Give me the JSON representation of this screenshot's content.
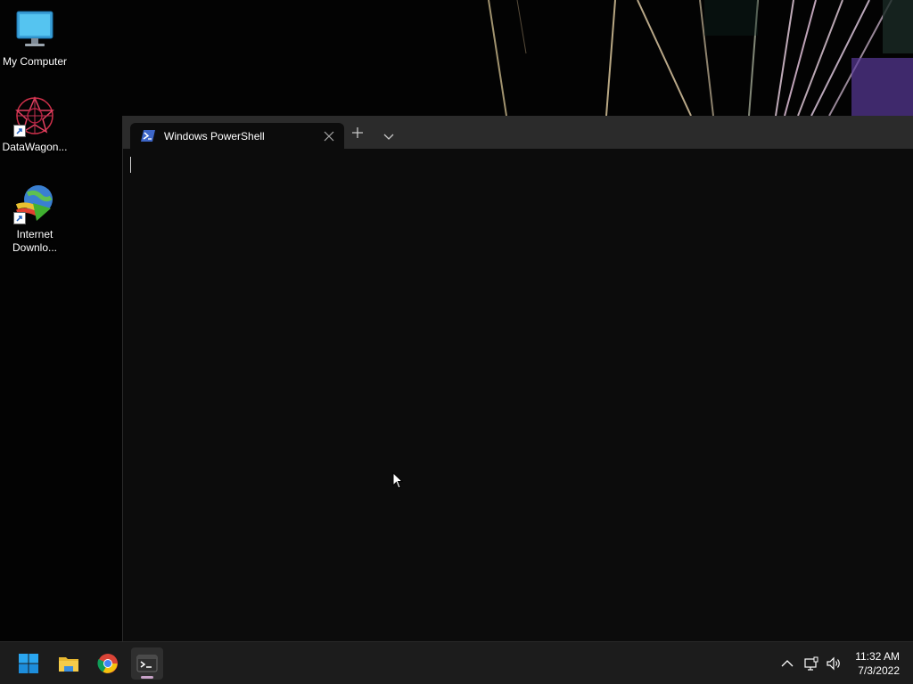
{
  "desktop": {
    "icons": [
      {
        "label": "My Computer",
        "icon": "monitor-icon"
      },
      {
        "label": "DataWagon...",
        "icon": "datawagon-icon"
      },
      {
        "label": "Internet Downlo...",
        "icon": "internet-download-manager-icon"
      }
    ]
  },
  "terminal": {
    "tab_title": "Windows PowerShell",
    "tab_icon": "powershell-icon",
    "new_tab_icon": "plus-icon",
    "dropdown_icon": "chevron-down-icon",
    "close_icon": "close-icon"
  },
  "taskbar": {
    "apps": [
      {
        "name": "Start",
        "icon": "windows-start-icon"
      },
      {
        "name": "File Explorer",
        "icon": "folder-icon"
      },
      {
        "name": "Google Chrome",
        "icon": "chrome-icon"
      },
      {
        "name": "Windows Terminal",
        "icon": "terminal-icon",
        "active": true
      }
    ],
    "tray": {
      "overflow_icon": "chevron-up-icon",
      "network_icon": "network-icon",
      "volume_icon": "volume-icon"
    },
    "time": "11:32 AM",
    "date": "7/3/2022"
  },
  "colors": {
    "terminal_bg": "#0c0c0c",
    "titlebar_bg": "#2b2b2b",
    "taskbar_bg": "#1c1c1c",
    "accent": "#c8a2c8"
  }
}
